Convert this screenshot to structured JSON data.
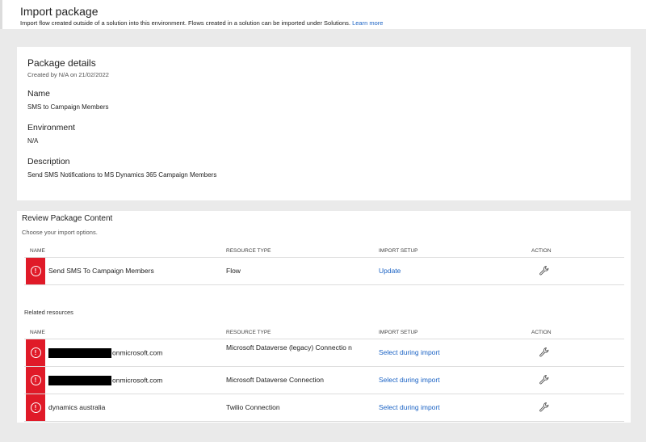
{
  "header": {
    "title": "Import package",
    "subtitle": "Import flow created outside of a solution into this environment. Flows created in a solution can be imported under Solutions.",
    "learn_more": "Learn more"
  },
  "details": {
    "title": "Package details",
    "created": "Created by N/A on 21/02/2022",
    "name_label": "Name",
    "name_value": "SMS to Campaign Members",
    "env_label": "Environment",
    "env_value": "N/A",
    "desc_label": "Description",
    "desc_value": "Send SMS Notifications to MS Dynamics 365 Campaign Members"
  },
  "review": {
    "title": "Review Package Content",
    "subtitle": "Choose your import options.",
    "columns": {
      "name": "NAME",
      "type": "RESOURCE TYPE",
      "setup": "IMPORT SETUP",
      "action": "ACTION"
    },
    "main_rows": [
      {
        "name": "Send SMS To Campaign Members",
        "type": "Flow",
        "setup": "Update"
      }
    ],
    "related_label": "Related resources",
    "related_rows": [
      {
        "name_suffix": "onmicrosoft.com",
        "type": "Microsoft Dataverse (legacy) Connectio n",
        "setup": "Select during import"
      },
      {
        "name_suffix": "onmicrosoft.com",
        "type": "Microsoft Dataverse Connection",
        "setup": "Select during import"
      },
      {
        "name": "dynamics australia",
        "type": "Twilio Connection",
        "setup": "Select during import"
      }
    ]
  },
  "colors": {
    "error": "#e01a28",
    "link": "#1a62c4"
  }
}
